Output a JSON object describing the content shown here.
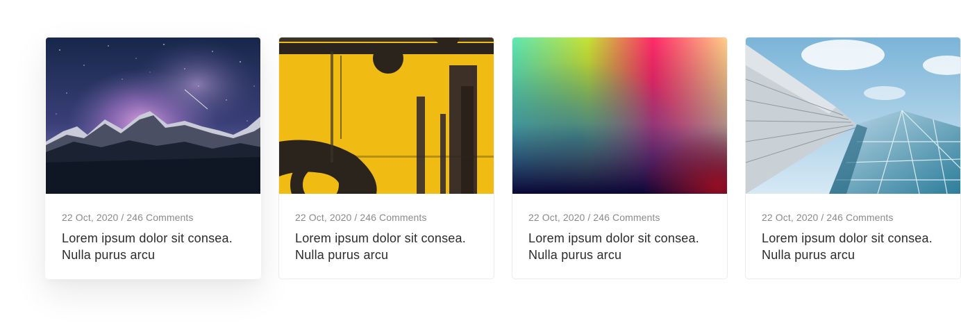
{
  "cards": [
    {
      "image_icon": "mountain-milky-way-photo",
      "meta": "22 Oct, 2020 / 246 Comments",
      "title": "Lorem ipsum dolor sit consea. Nulla purus arcu"
    },
    {
      "image_icon": "yellow-painted-wall-photo",
      "meta": "22 Oct, 2020 / 246 Comments",
      "title": "Lorem ipsum dolor sit consea. Nulla purus arcu"
    },
    {
      "image_icon": "color-gradient-image",
      "meta": "22 Oct, 2020 / 246 Comments",
      "title": "Lorem ipsum dolor sit consea. Nulla purus arcu"
    },
    {
      "image_icon": "glass-building-photo",
      "meta": "22 Oct, 2020 / 246 Comments",
      "title": "Lorem ipsum dolor sit consea. Nulla purus arcu"
    }
  ],
  "colors": {
    "meta_text": "#8a8a8a",
    "title_text": "#2b2b2b",
    "card_border": "#ececec"
  }
}
